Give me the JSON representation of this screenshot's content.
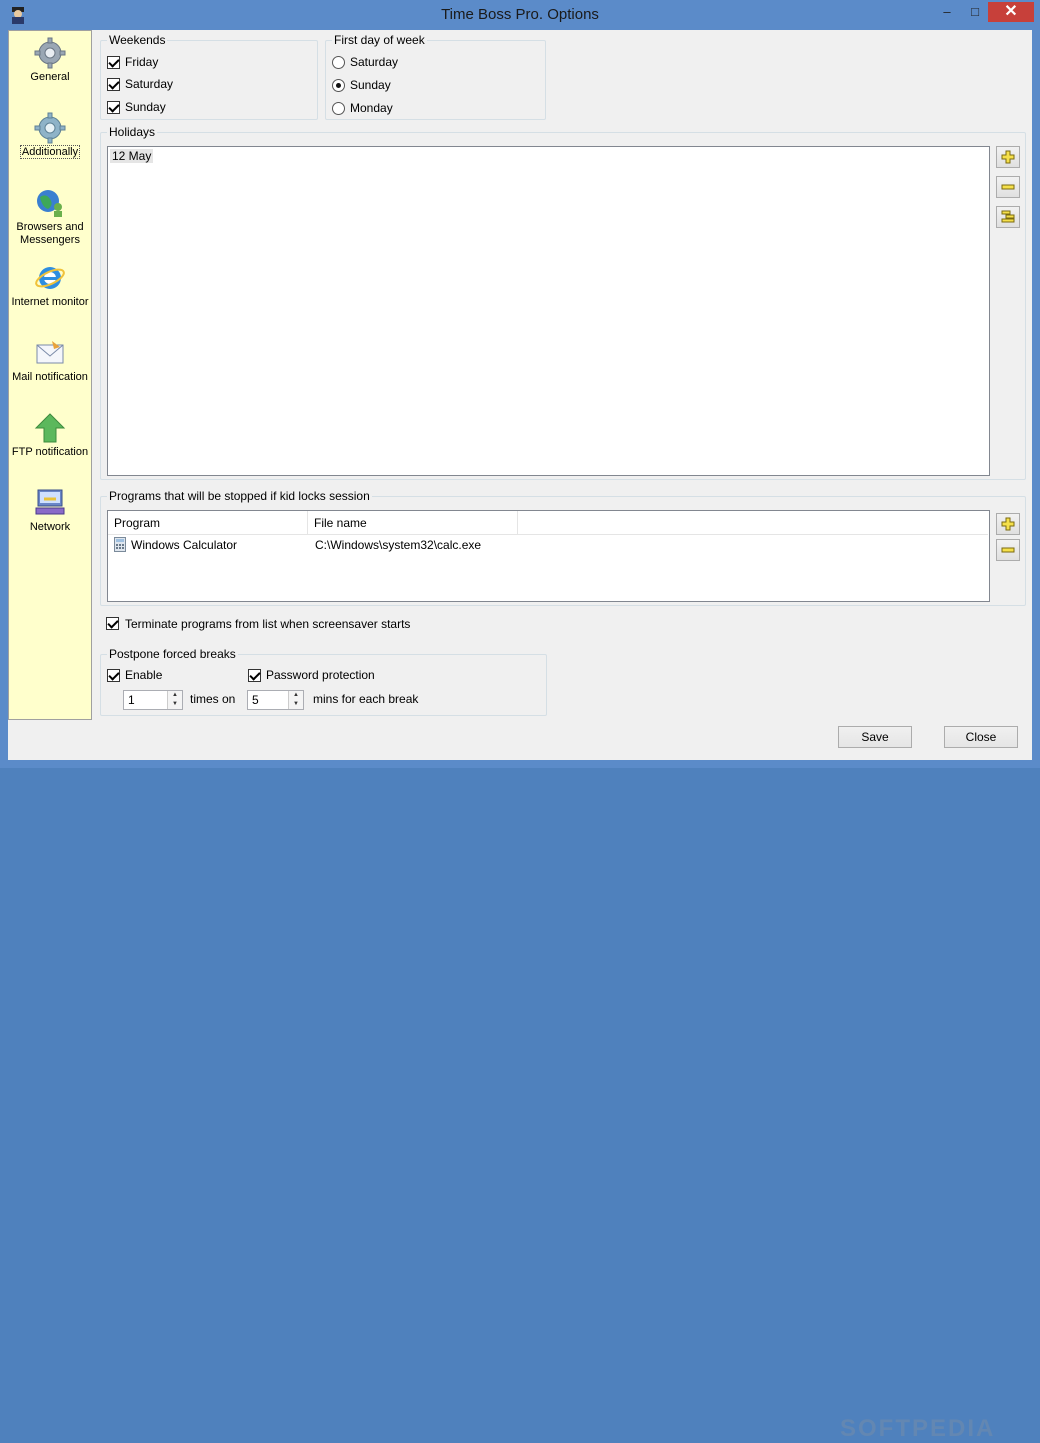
{
  "window": {
    "title": "Time Boss Pro. Options",
    "minimize": "–",
    "maximize": "□",
    "close": "✕"
  },
  "sidebar": {
    "items": [
      {
        "label": "General",
        "icon": "gear-icon"
      },
      {
        "label": "Additionally",
        "icon": "gear-icon",
        "active": true
      },
      {
        "label": "Browsers and Messengers",
        "icon": "globe-people-icon"
      },
      {
        "label": "Internet monitor",
        "icon": "internet-explorer-icon"
      },
      {
        "label": "Mail notification",
        "icon": "mail-icon"
      },
      {
        "label": "FTP notification",
        "icon": "up-arrow-icon"
      },
      {
        "label": "Network",
        "icon": "network-icon"
      }
    ]
  },
  "weekends": {
    "legend": "Weekends",
    "options": [
      {
        "label": "Friday",
        "checked": true
      },
      {
        "label": "Saturday",
        "checked": true
      },
      {
        "label": "Sunday",
        "checked": true
      }
    ]
  },
  "first_day": {
    "legend": "First day of week",
    "options": [
      {
        "label": "Saturday",
        "selected": false
      },
      {
        "label": "Sunday",
        "selected": true
      },
      {
        "label": "Monday",
        "selected": false
      }
    ]
  },
  "holidays": {
    "legend": "Holidays",
    "items": [
      "12 May"
    ]
  },
  "programs": {
    "legend": "Programs that will be stopped if kid locks session",
    "columns": [
      "Program",
      "File name"
    ],
    "rows": [
      {
        "program": "Windows Calculator",
        "file": "C:\\Windows\\system32\\calc.exe"
      }
    ]
  },
  "terminate": {
    "label": "Terminate programs from list when screensaver starts",
    "checked": true
  },
  "postpone": {
    "legend": "Postpone forced breaks",
    "enable_label": "Enable",
    "enable_checked": true,
    "password_label": "Password protection",
    "password_checked": true,
    "times_value": "1",
    "times_label": "times on",
    "mins_value": "5",
    "mins_label": "mins for each break"
  },
  "footer": {
    "save": "Save",
    "close": "Close",
    "watermark": "SOFTPEDIA"
  }
}
